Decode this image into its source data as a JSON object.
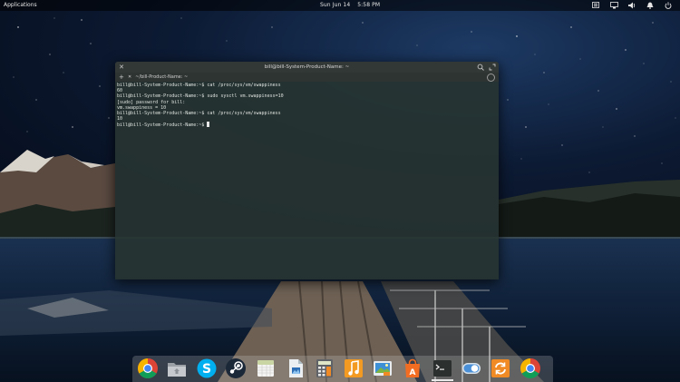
{
  "top_panel": {
    "applications_label": "Applications",
    "date": "Sun Jun 14",
    "time": "5:58 PM",
    "indicators": [
      "keyboard-layout-icon",
      "network-icon",
      "volume-icon",
      "notifications-icon",
      "power-icon"
    ]
  },
  "terminal": {
    "window_title": "bill@bill-System-Product-Name: ~",
    "tab_label": "~/bill-Product-Name: ~",
    "new_tab_label": "+",
    "tab_close_label": "✕",
    "lines": [
      "bill@bill-System-Product-Name:~$ cat /proc/sys/vm/swappiness",
      "60",
      "bill@bill-System-Product-Name:~$ sudo sysctl vm.swappiness=10",
      "[sudo] password for bill:",
      "vm.swappiness = 10",
      "bill@bill-System-Product-Name:~$ cat /proc/sys/vm/swappiness",
      "10",
      "bill@bill-System-Product-Name:~$ "
    ]
  },
  "dock": {
    "items": [
      "chrome-icon",
      "files-icon",
      "skype-icon",
      "steam-icon",
      "calendar-icon",
      "document-viewer-icon",
      "calculator-icon",
      "music-icon",
      "photos-icon",
      "software-center-icon",
      "terminal-icon",
      "settings-toggle-icon",
      "update-icon",
      "chrome-icon"
    ],
    "running_item": "terminal-icon"
  },
  "colors": {
    "terminal_bg": "#273431",
    "titlebar_bg": "#323836",
    "panel_bg": "#000000",
    "accent_orange": "#f08a24"
  }
}
